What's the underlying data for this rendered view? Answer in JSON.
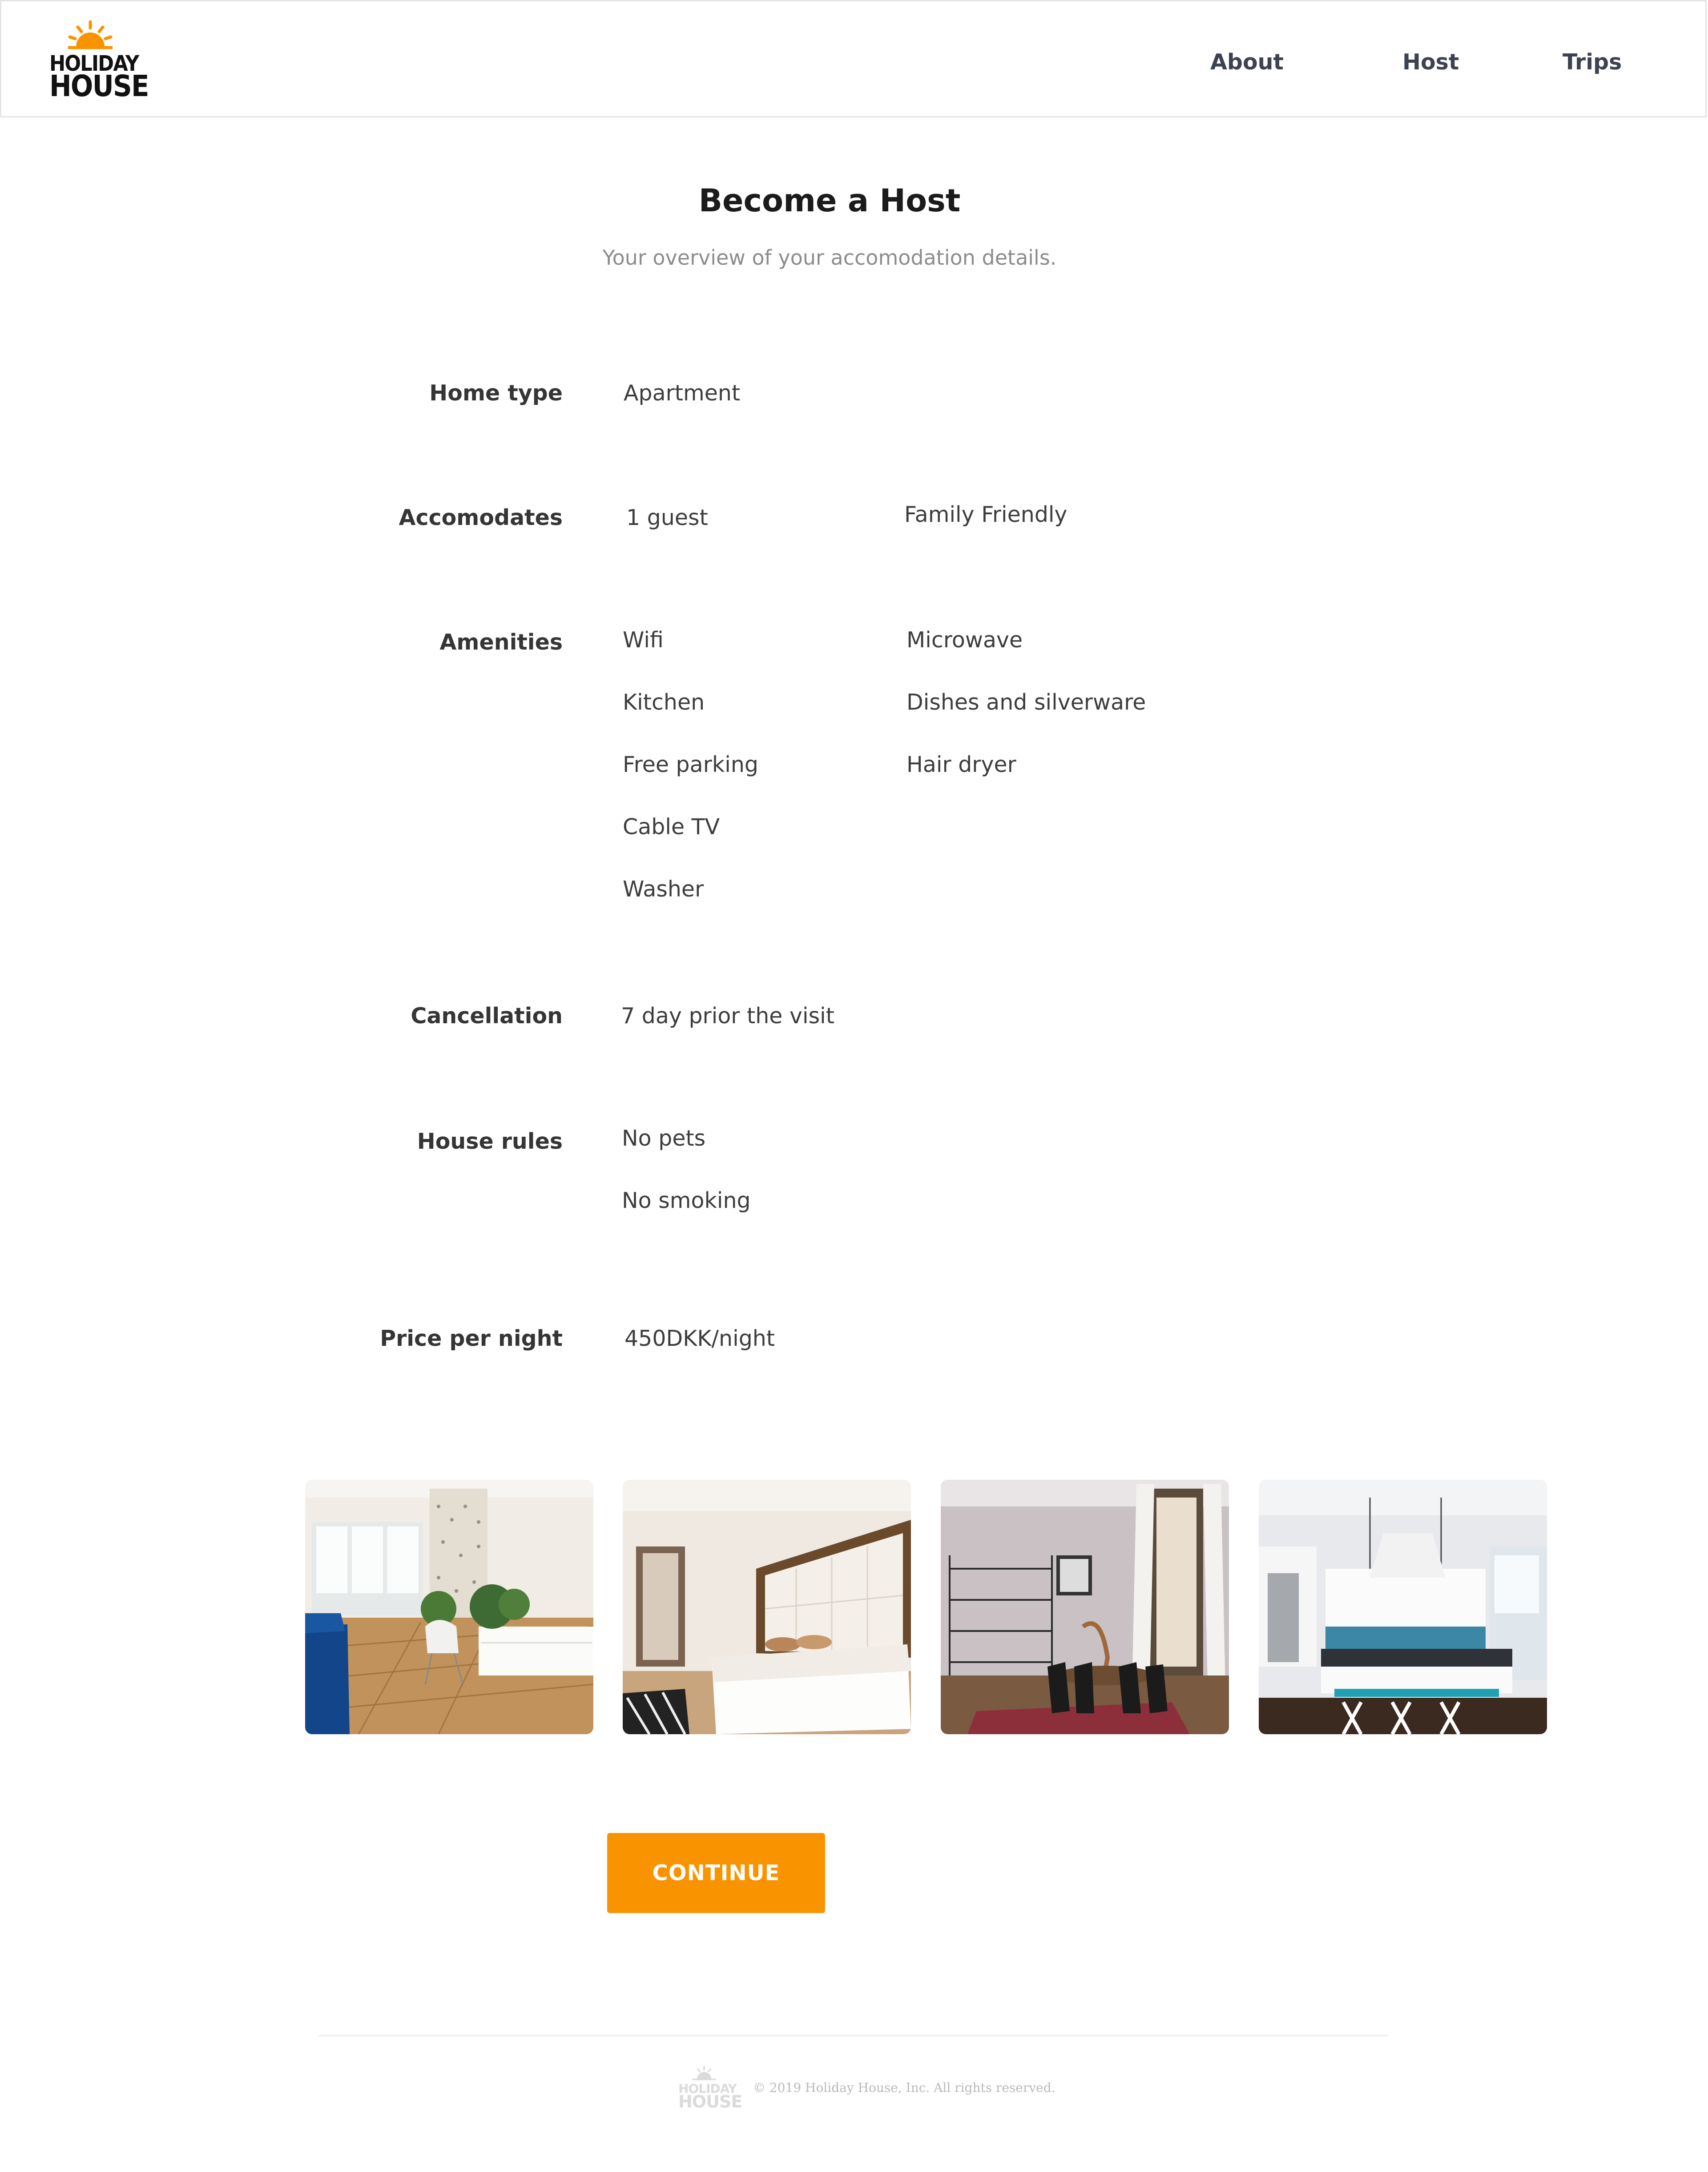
{
  "brand": {
    "line1": "HOLIDAY",
    "line2": "HOUSE",
    "accent_color": "#fa9300"
  },
  "nav": {
    "about": "About",
    "host": "Host",
    "trips": "Trips"
  },
  "page": {
    "title": "Become a Host",
    "subtitle": "Your overview of your accomodation details."
  },
  "details": {
    "home_type": {
      "label": "Home type",
      "value": "Apartment"
    },
    "accomodates": {
      "label": "Accomodates",
      "guests": "1 guest",
      "extra": "Family Friendly"
    },
    "amenities": {
      "label": "Amenities",
      "col1": [
        "Wifi",
        "Kitchen",
        "Free parking",
        "Cable TV",
        "Washer"
      ],
      "col2": [
        "Microwave",
        "Dishes and silverware",
        "Hair dryer"
      ]
    },
    "cancellation": {
      "label": "Cancellation",
      "value": "7 day prior the visit"
    },
    "house_rules": {
      "label": "House rules",
      "items": [
        "No pets",
        "No smoking"
      ]
    },
    "price": {
      "label": "Price per night",
      "value": "450DKK/night"
    }
  },
  "photos": [
    {
      "icon": "living-room-photo"
    },
    {
      "icon": "bedroom-photo"
    },
    {
      "icon": "dining-room-photo"
    },
    {
      "icon": "kitchen-photo"
    }
  ],
  "actions": {
    "continue_label": "CONTINUE"
  },
  "footer": {
    "logo_line1": "HOLIDAY",
    "logo_line2": "HOUSE",
    "copyright": "© 2019 Holiday House, Inc. All rights reserved."
  }
}
